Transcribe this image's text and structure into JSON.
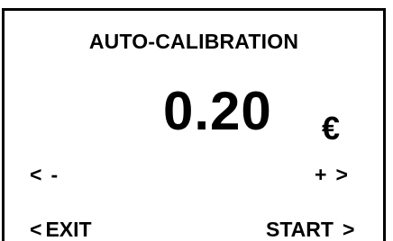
{
  "screen": {
    "title": "AUTO-CALIBRATION",
    "amount": "0.20",
    "currency": "€"
  },
  "controls": {
    "decrease": {
      "arrow": "<",
      "label": "-"
    },
    "increase": {
      "label": "+",
      "arrow": ">"
    },
    "exit": {
      "arrow": "<",
      "label": "EXIT"
    },
    "start": {
      "label": "START",
      "arrow": ">"
    }
  }
}
